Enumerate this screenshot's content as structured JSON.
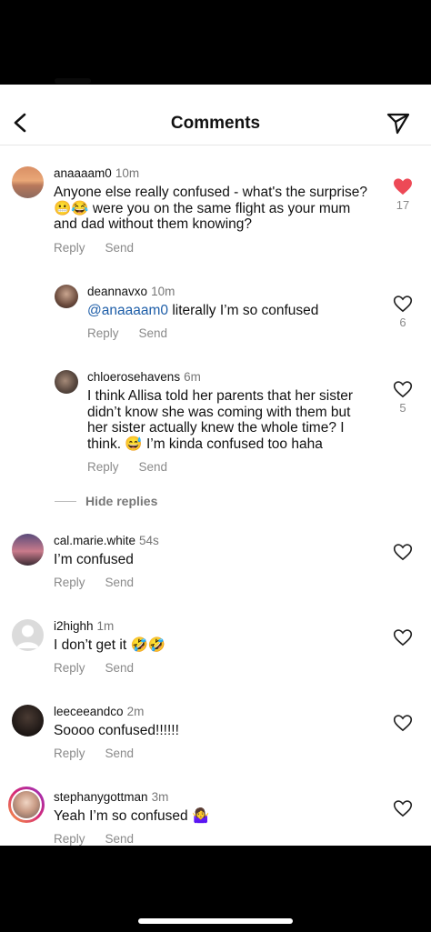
{
  "header": {
    "title": "Comments"
  },
  "actions": {
    "reply": "Reply",
    "send": "Send"
  },
  "hide_replies": "Hide replies",
  "comments": [
    {
      "username": "anaaaam0",
      "time": "10m",
      "text": "Anyone else really confused - what's the surprise? 😬😂 were you on the same flight as your mum and dad without them knowing?",
      "likes": "17",
      "liked": true
    },
    {
      "username": "deannavxo",
      "time": "10m",
      "mention": "@anaaaam0",
      "text": "literally I’m so confused",
      "likes": "6",
      "liked": false
    },
    {
      "username": "chloerosehavens",
      "time": "6m",
      "text": "I think Allisa told her parents that her sister didn’t know she was coming with them but her sister actually knew the whole time? I think. 😅 I’m kinda confused too haha",
      "likes": "5",
      "liked": false
    },
    {
      "username": "cal.marie.white",
      "time": "54s",
      "text": "I’m confused",
      "liked": false
    },
    {
      "username": "i2highh",
      "time": "1m",
      "text": "I don’t get it 🤣🤣",
      "liked": false
    },
    {
      "username": "leeceeandco",
      "time": "2m",
      "text": "Soooo confused!!!!!!",
      "liked": false
    },
    {
      "username": "stephanygottman",
      "time": "3m",
      "text": "Yeah I’m so confused 🤷‍♀️",
      "liked": false
    }
  ],
  "colors": {
    "like_active": "#ed4956",
    "mention": "#1e5ea8"
  }
}
